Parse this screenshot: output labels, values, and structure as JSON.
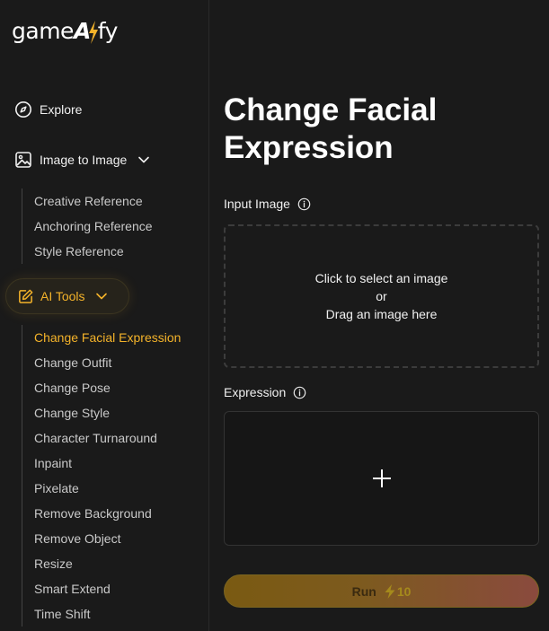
{
  "app": {
    "logo_text_left": "game",
    "logo_text_a": "A",
    "logo_text_right": "fy"
  },
  "nav": {
    "explore_label": "Explore",
    "image_to_image_label": "Image to Image",
    "image_to_image_items": [
      "Creative Reference",
      "Anchoring Reference",
      "Style Reference"
    ],
    "ai_tools_label": "AI Tools",
    "ai_tools_items": [
      "Change Facial Expression",
      "Change Outfit",
      "Change Pose",
      "Change Style",
      "Character Turnaround",
      "Inpaint",
      "Pixelate",
      "Remove Background",
      "Remove Object",
      "Resize",
      "Smart Extend",
      "Time Shift"
    ],
    "active_item": "Change Facial Expression"
  },
  "main": {
    "title": "Change Facial Expression",
    "input_image_label": "Input Image",
    "dropzone_line1": "Click to select an image",
    "dropzone_line2": "or",
    "dropzone_line3": "Drag an image here",
    "expression_label": "Expression",
    "run_label": "Run",
    "run_cost": "10"
  },
  "colors": {
    "accent": "#f4b32a",
    "background": "#1a1a1a",
    "active_text": "#f4b32a"
  },
  "icons": {
    "explore": "compass-icon",
    "image_to_image": "image-icon",
    "ai_tools": "edit-icon",
    "info": "info-icon",
    "add": "plus-icon",
    "cost": "bolt-icon",
    "expand": "chevron-down-icon"
  }
}
